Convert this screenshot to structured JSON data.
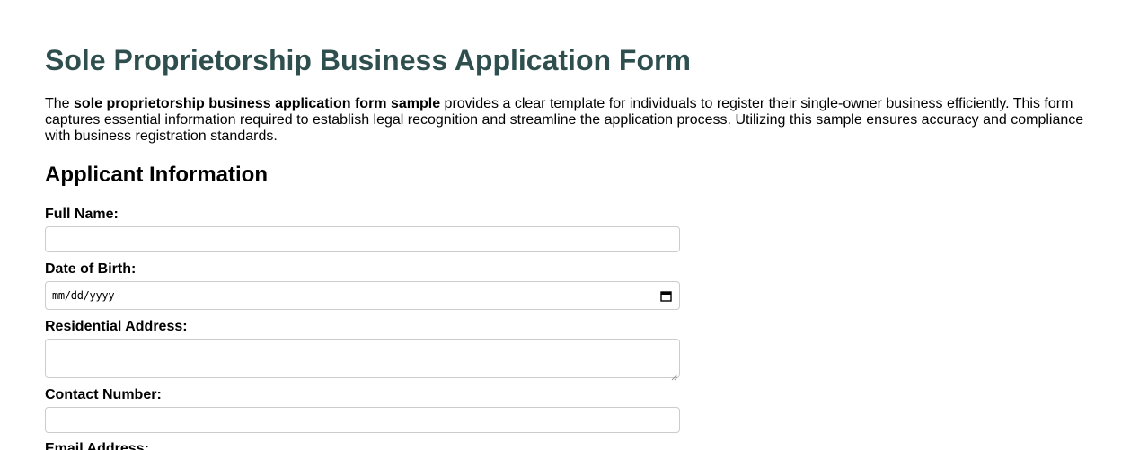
{
  "page": {
    "title": "Sole Proprietorship Business Application Form",
    "intro_prefix": "The ",
    "intro_bold": "sole proprietorship business application form sample",
    "intro_suffix": " provides a clear template for individuals to register their single-owner business efficiently. This form captures essential information required to establish legal recognition and streamline the application process. Utilizing this sample ensures accuracy and compliance with business registration standards."
  },
  "section": {
    "heading": "Applicant Information"
  },
  "fields": {
    "full_name": {
      "label": "Full Name:",
      "value": ""
    },
    "date_of_birth": {
      "label": "Date of Birth:",
      "placeholder": "mm/dd/yyyy"
    },
    "residential_address": {
      "label": "Residential Address:",
      "value": ""
    },
    "contact_number": {
      "label": "Contact Number:",
      "value": ""
    },
    "email_address": {
      "label": "Email Address:"
    }
  },
  "colors": {
    "title": "#2f4f4f",
    "field_border": "#cccccc"
  },
  "icons": {
    "date_picker": "calendar-icon"
  }
}
